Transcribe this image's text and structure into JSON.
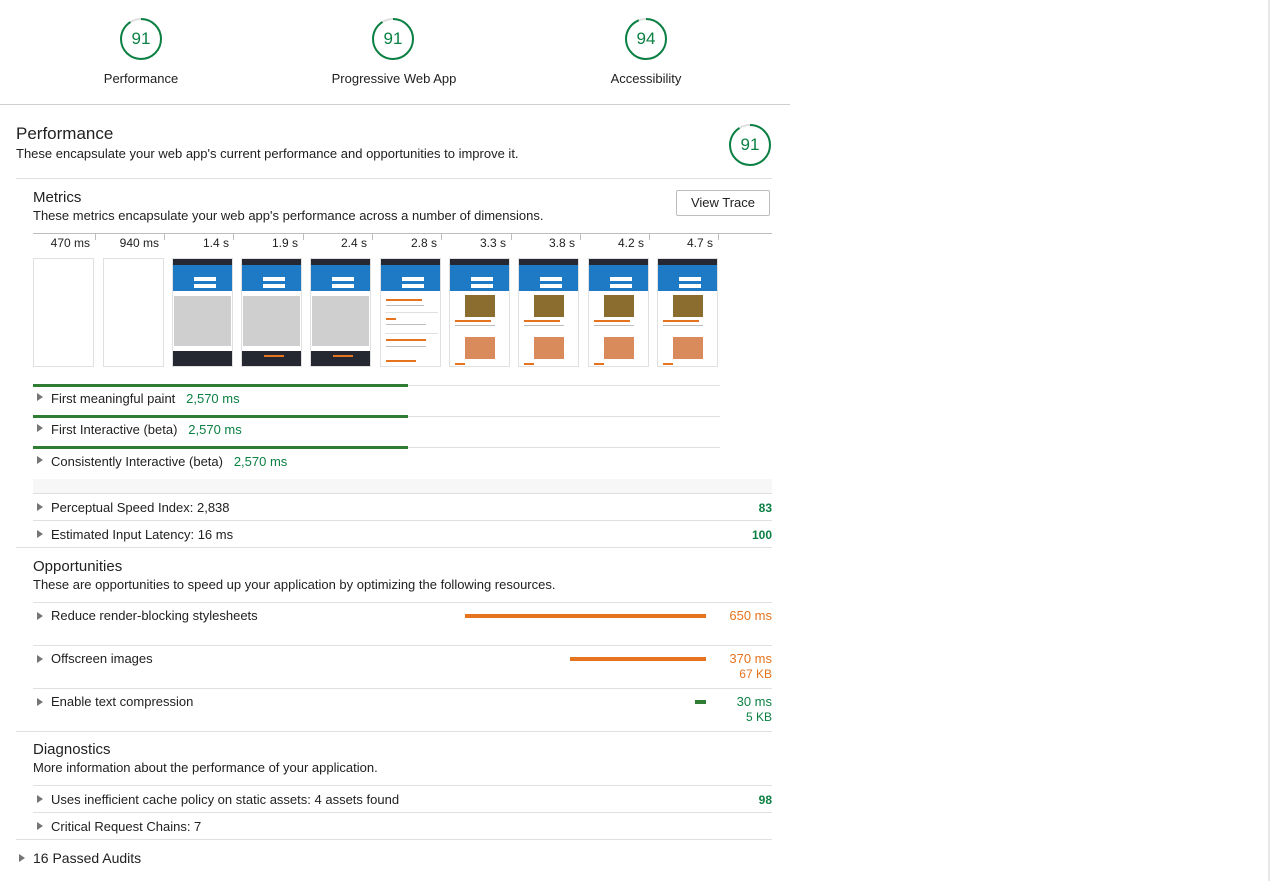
{
  "header_scores": [
    {
      "value": "91",
      "label": "Performance",
      "fraction": 0.91
    },
    {
      "value": "91",
      "label": "Progressive Web App",
      "fraction": 0.91
    },
    {
      "value": "94",
      "label": "Accessibility",
      "fraction": 0.94
    }
  ],
  "performance": {
    "title": "Performance",
    "description": "These encapsulate your web app's current performance and opportunities to improve it.",
    "score": "91",
    "score_fraction": 0.91
  },
  "metrics": {
    "title": "Metrics",
    "description": "These metrics encapsulate your web app's performance across a number of dimensions.",
    "view_trace_label": "View Trace",
    "ticks": [
      "470 ms",
      "940 ms",
      "1.4 s",
      "1.9 s",
      "2.4 s",
      "2.8 s",
      "3.3 s",
      "3.8 s",
      "4.2 s",
      "4.7 s"
    ],
    "rows": [
      {
        "label": "First meaningful paint",
        "value": "2,570 ms"
      },
      {
        "label": "First Interactive (beta)",
        "value": "2,570 ms"
      },
      {
        "label": "Consistently Interactive (beta)",
        "value": "2,570 ms"
      }
    ],
    "scored_rows": [
      {
        "label": "Perceptual Speed Index: 2,838",
        "score": "83"
      },
      {
        "label": "Estimated Input Latency: 16 ms",
        "score": "100"
      }
    ]
  },
  "opportunities": {
    "title": "Opportunities",
    "description": "These are opportunities to speed up your application by optimizing the following resources.",
    "items": [
      {
        "label": "Reduce render-blocking stylesheets",
        "time": "650 ms",
        "size": ""
      },
      {
        "label": "Offscreen images",
        "time": "370 ms",
        "size": "67 KB"
      },
      {
        "label": "Enable text compression",
        "time": "30 ms",
        "size": "5 KB"
      }
    ]
  },
  "diagnostics": {
    "title": "Diagnostics",
    "description": "More information about the performance of your application.",
    "items": [
      {
        "label": "Uses inefficient cache policy on static assets: 4 assets found",
        "score": "98"
      },
      {
        "label": "Critical Request Chains: 7",
        "score": ""
      }
    ]
  },
  "passed_audits": "16 Passed Audits",
  "colors": {
    "pass": "#0b8043",
    "average": "#e6731e",
    "text": "#212121"
  }
}
